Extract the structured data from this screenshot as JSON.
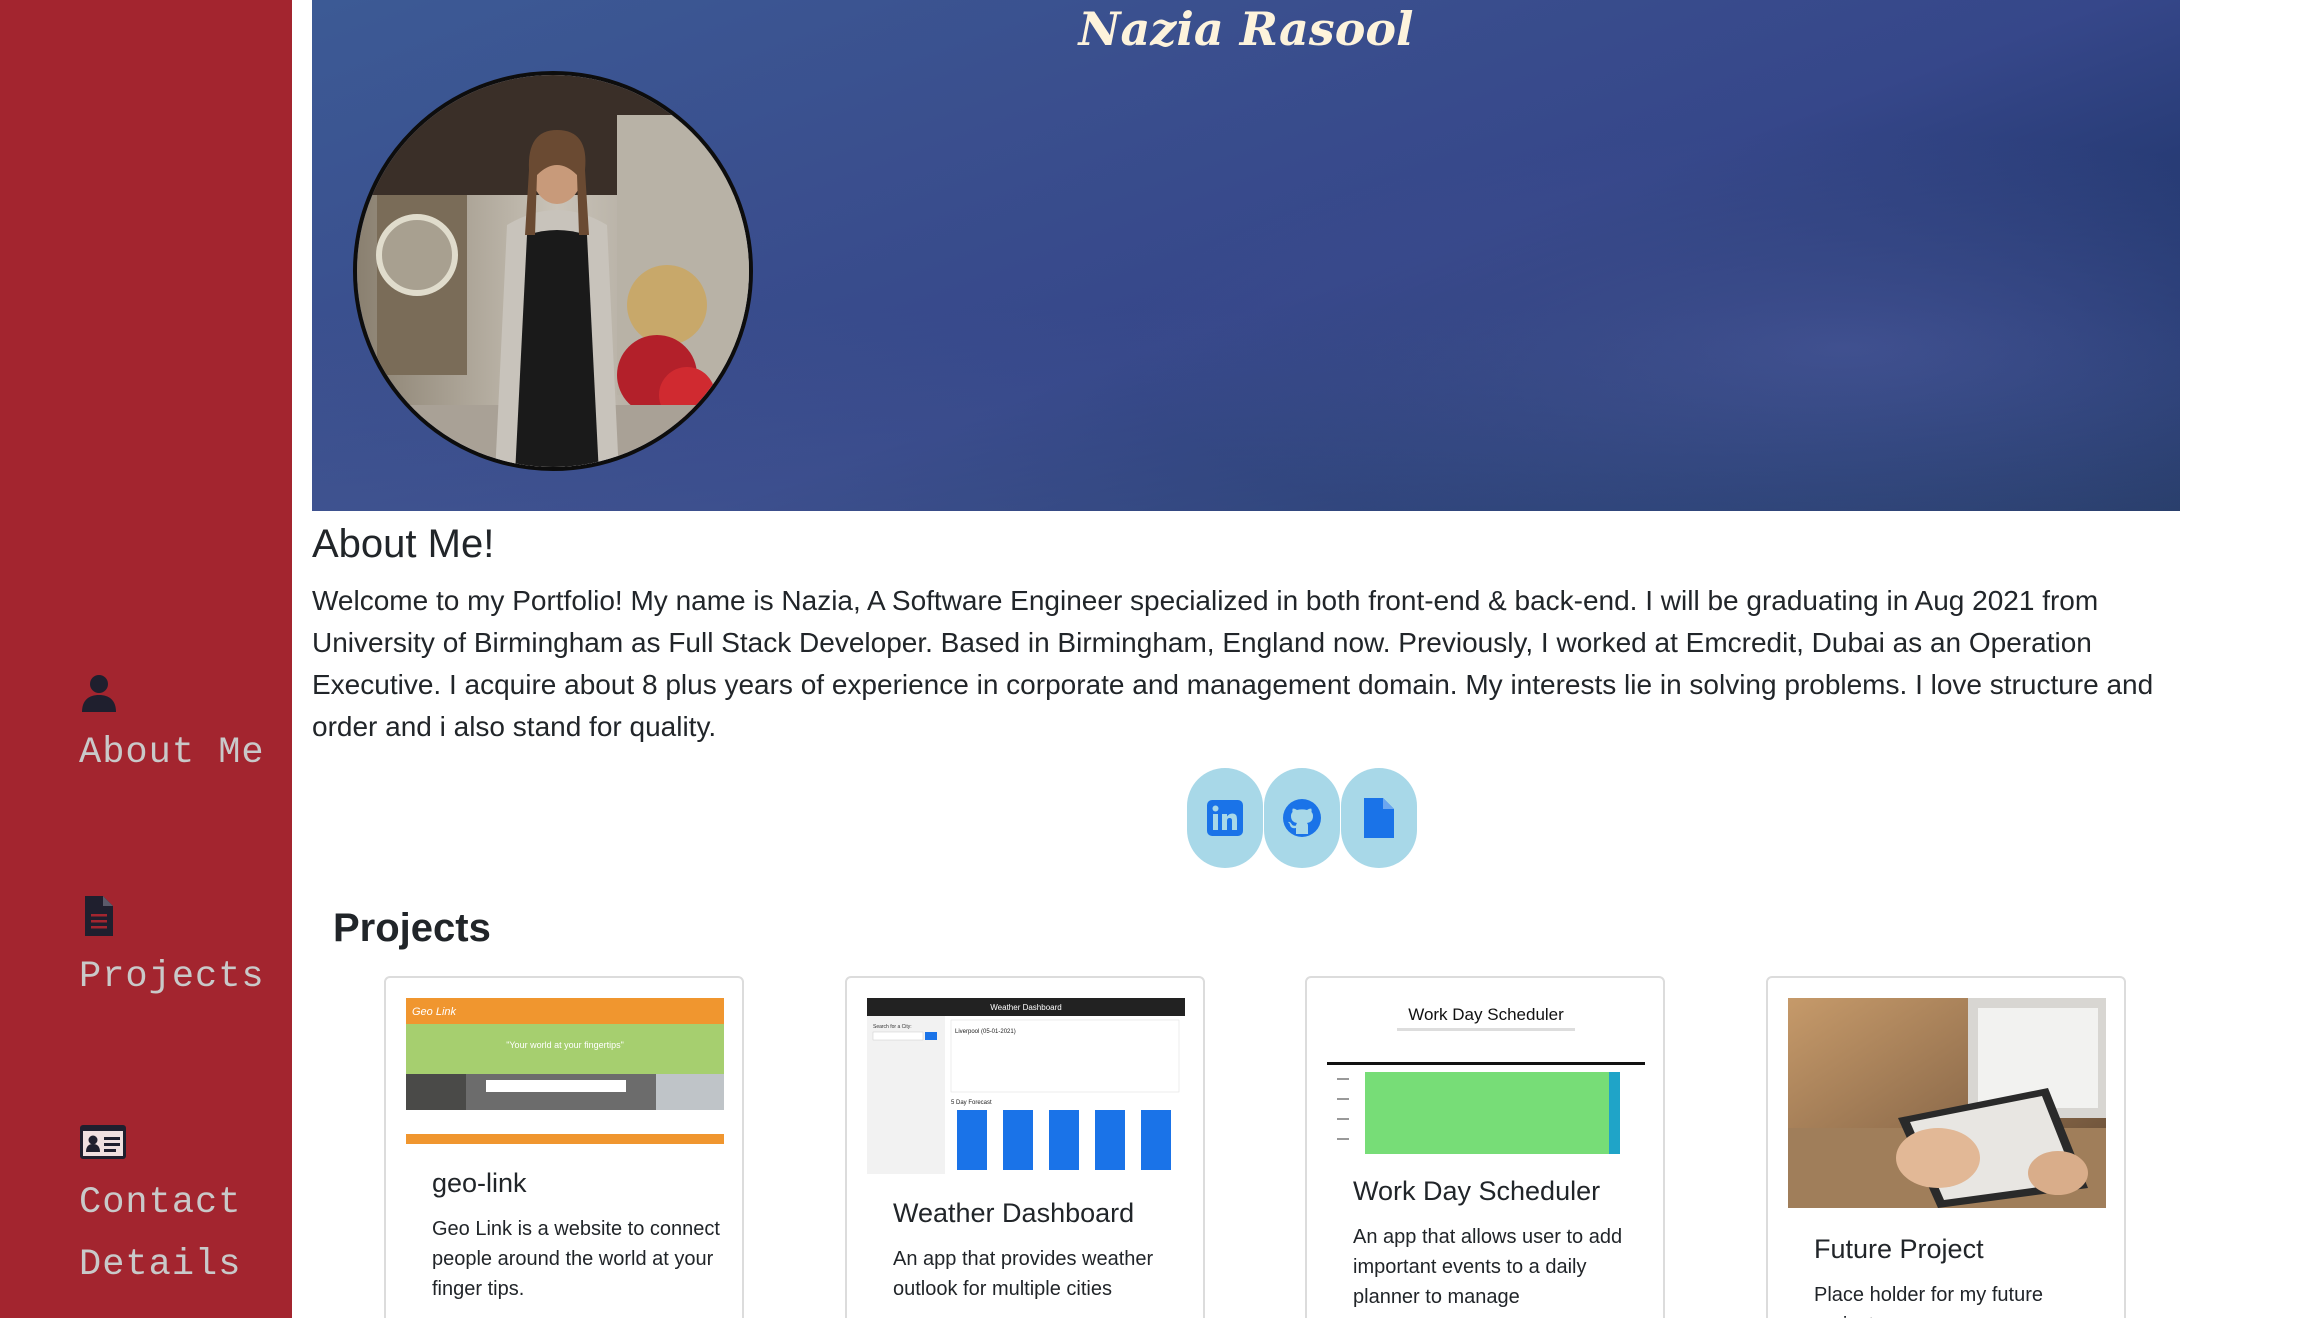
{
  "sidebar": {
    "items": [
      {
        "label_line1": "About Me",
        "label_line2": "",
        "icon": "user-icon"
      },
      {
        "label_line1": "Projects",
        "label_line2": "",
        "icon": "document-icon"
      },
      {
        "label_line1": "Contact",
        "label_line2": "Details",
        "icon": "id-card-icon"
      }
    ]
  },
  "header": {
    "name": "Nazia Rasool"
  },
  "about": {
    "title": "About Me!",
    "text": "Welcome to my Portfolio! My name is Nazia, A Software Engineer specialized in both front-end & back-end. I will be graduating in Aug 2021 from University of Birmingham as Full Stack Developer. Based in Birmingham, England now. Previously, I worked at Emcredit, Dubai as an Operation Executive. I acquire about 8 plus years of experience in corporate and management domain. My interests lie in solving problems. I love structure and order and i also stand for quality."
  },
  "social": [
    "linkedin-icon",
    "github-icon",
    "resume-icon"
  ],
  "projects": {
    "title": "Projects",
    "cards": [
      {
        "title": "geo-link",
        "text": "Geo Link is a website to connect people around the world at your finger tips.",
        "thumb": {
          "tagline": "\"Your world at your fingertips\"",
          "logo": "Geo Link"
        }
      },
      {
        "title": "Weather Dashboard",
        "text": "An app that provides weather outlook for multiple cities",
        "thumb": {
          "header": "Weather Dashboard",
          "search_label": "Search for a City:",
          "city": "Liverpool (05-01-2021)",
          "forecast": "5 Day Forecast"
        }
      },
      {
        "title": "Work Day Scheduler",
        "text": "An app that allows user to add important events to a daily planner to manage",
        "thumb": {
          "heading": "Work Day Scheduler"
        }
      },
      {
        "title": "Future Project",
        "text": "Place holder for my future projects"
      }
    ]
  }
}
